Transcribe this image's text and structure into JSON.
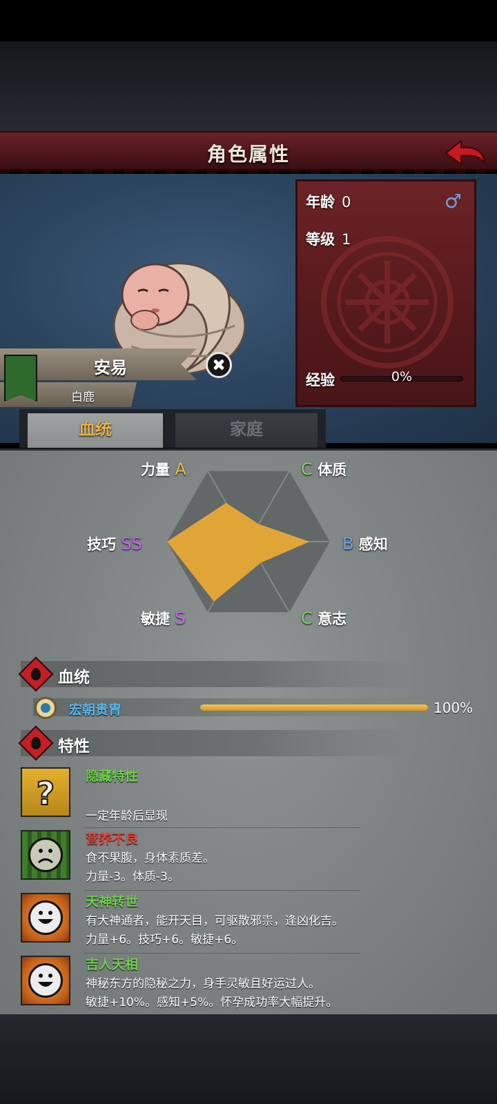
{
  "header": {
    "title": "角色属性"
  },
  "character": {
    "name": "安易",
    "clan": "白鹿",
    "age_label": "年龄",
    "age": "0",
    "level_label": "等级",
    "level": "1",
    "exp_label": "经验",
    "exp_text": "0%",
    "exp_fraction": 0,
    "gender_icon": "male-symbol-icon",
    "gender_glyph": "♂"
  },
  "tabs": {
    "bloodline": "血统",
    "family": "家庭",
    "active": "bloodline"
  },
  "stats": {
    "strength": {
      "label": "力量",
      "grade": "A"
    },
    "constitution": {
      "label": "体质",
      "grade": "C"
    },
    "skill": {
      "label": "技巧",
      "grade": "SS"
    },
    "perception": {
      "label": "感知",
      "grade": "B"
    },
    "agility": {
      "label": "敏捷",
      "grade": "S"
    },
    "will": {
      "label": "意志",
      "grade": "C"
    }
  },
  "radar_values": {
    "strength": 0.55,
    "constitution": 0.25,
    "perception": 0.75,
    "will": 0.3,
    "agility": 0.85,
    "skill": 1.0
  },
  "colors": {
    "radar_fill": "#e1a437",
    "grade_A": "#e3c34a",
    "grade_B": "#6aa6e3",
    "grade_C": "#7dd464",
    "grade_S": "#c86be6",
    "accent_red": "#c31f25"
  },
  "bloodline_section": {
    "title": "血统",
    "entry_name": "宏朝贵胄",
    "entry_percent_text": "100%",
    "entry_fraction": 1.0
  },
  "traits_section": {
    "title": "特性"
  },
  "traits": [
    {
      "name": "隐藏特性",
      "line1": "",
      "line2": "一定年龄后显现"
    },
    {
      "name": "营养不良",
      "line1": "食不果腹，身体素质差。",
      "line2": "力量-3。体质-3。"
    },
    {
      "name": "天神转世",
      "line1": "有大神通者，能开天目，可驱散邪祟，逢凶化吉。",
      "line2": "力量+6。技巧+6。敏捷+6。"
    },
    {
      "name": "吉人天相",
      "line1": "神秘东方的隐秘之力，身手灵敏且好运过人。",
      "line2": "敏捷+10%。感知+5%。怀孕成功率大幅提升。"
    }
  ]
}
